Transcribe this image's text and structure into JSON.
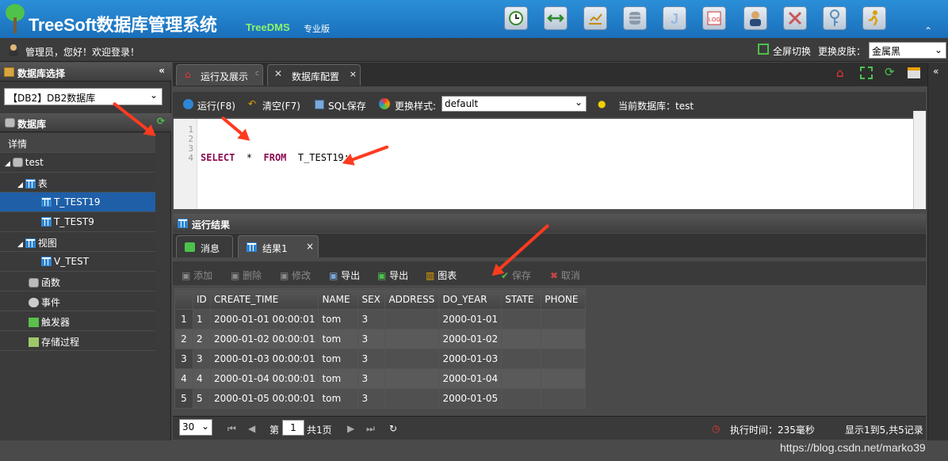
{
  "app": {
    "title": "TreeSoft数据库管理系统",
    "subtitle": "TreeDMS",
    "edition": "专业版"
  },
  "header_tools": [
    "clock-icon",
    "swap-icon",
    "chart-icon",
    "database-icon",
    "j-icon",
    "log-icon",
    "user-admin-icon",
    "tools-icon",
    "key-icon",
    "run-icon"
  ],
  "userbar": {
    "welcome": "管理员，您好！欢迎登录！",
    "fullscreen": "全屏切换",
    "skin_label": "更换皮肤：",
    "skin_value": "金属黑"
  },
  "left": {
    "db_select_title": "数据库选择",
    "db_select_value": "【DB2】DB2数据库",
    "db_title": "数据库",
    "detail": "详情",
    "tree": [
      {
        "label": "test"
      },
      {
        "label": "表"
      },
      {
        "label": "T_TEST19"
      },
      {
        "label": "T_TEST9"
      },
      {
        "label": "视图"
      },
      {
        "label": "V_TEST"
      },
      {
        "label": "函数"
      },
      {
        "label": "事件"
      },
      {
        "label": "触发器"
      },
      {
        "label": "存储过程"
      }
    ]
  },
  "tabs": {
    "run": "运行及展示",
    "config": "数据库配置"
  },
  "toolbar": {
    "run": "运行(F8)",
    "clear": "清空(F7)",
    "save_sql": "SQL保存",
    "change_style": "更换样式:",
    "style_value": "default",
    "current_db": "当前数据库：test"
  },
  "editor": {
    "lines": [
      "1",
      "2",
      "3",
      "4"
    ],
    "kw1": "SELECT",
    "star": "*",
    "kw2": "FROM",
    "table": "T_TEST19;"
  },
  "result": {
    "title": "运行结果",
    "tab_msg": "消息",
    "tab_result": "结果1",
    "actions": {
      "add": "添加",
      "delete": "删除",
      "edit": "修改",
      "export1": "导出",
      "export2": "导出",
      "chart": "图表",
      "save": "保存",
      "cancel": "取消"
    },
    "columns": [
      "ID",
      "CREATE_TIME",
      "NAME",
      "SEX",
      "ADDRESS",
      "DO_YEAR",
      "STATE",
      "PHONE"
    ],
    "rows": [
      [
        "1",
        "1",
        "2000-01-01 00:00:01",
        "tom",
        "3",
        "",
        "2000-01-01",
        "",
        ""
      ],
      [
        "2",
        "2",
        "2000-01-02 00:00:01",
        "tom",
        "3",
        "",
        "2000-01-02",
        "",
        ""
      ],
      [
        "3",
        "3",
        "2000-01-03 00:00:01",
        "tom",
        "3",
        "",
        "2000-01-03",
        "",
        ""
      ],
      [
        "4",
        "4",
        "2000-01-04 00:00:01",
        "tom",
        "3",
        "",
        "2000-01-04",
        "",
        ""
      ],
      [
        "5",
        "5",
        "2000-01-05 00:00:01",
        "tom",
        "3",
        "",
        "2000-01-05",
        "",
        ""
      ]
    ]
  },
  "pager": {
    "size": "30",
    "page_prefix": "第",
    "page": "1",
    "page_suffix": "共1页",
    "exec_time": "执行时间：235毫秒",
    "summary": "显示1到5,共5记录"
  },
  "watermark": "https://blog.csdn.net/marko39",
  "colors": {
    "header": "#1a6fba",
    "selected": "#1f5fa8",
    "annotation": "#ff3b1f",
    "keyword": "#8b0a50"
  }
}
